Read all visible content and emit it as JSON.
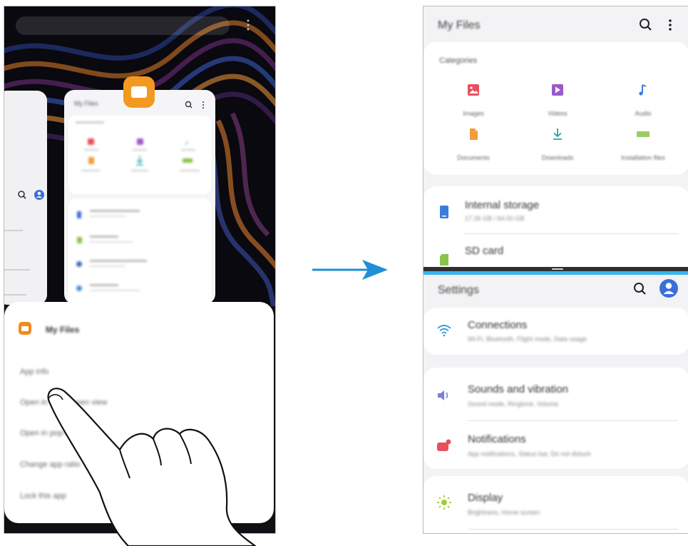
{
  "left_phone": {
    "thumbnail_title": "My Files",
    "sheet": {
      "title": "My Files",
      "menu_items": [
        "App info",
        "Open in split screen view",
        "Open in pop-up view",
        "Change app ratio",
        "Lock this app"
      ]
    }
  },
  "my_files": {
    "title": "My Files",
    "categories_header": "Categories",
    "categories": [
      {
        "label": "Images",
        "icon": "image-icon",
        "color": "#e8505b"
      },
      {
        "label": "Videos",
        "icon": "video-icon",
        "color": "#9b59c9"
      },
      {
        "label": "Audio",
        "icon": "music-icon",
        "color": "#3b7ddd"
      },
      {
        "label": "Documents",
        "icon": "document-icon",
        "color": "#f39c3a"
      },
      {
        "label": "Downloads",
        "icon": "download-icon",
        "color": "#22a7a0"
      },
      {
        "label": "Installation files",
        "icon": "apk-icon",
        "color": "#8bc34a"
      }
    ],
    "storage": [
      {
        "title": "Internal storage",
        "sub": "17.26 GB / 64.00 GB",
        "icon": "phone-storage-icon"
      },
      {
        "title": "SD card",
        "sub": "",
        "icon": "sd-card-icon"
      }
    ]
  },
  "settings": {
    "title": "Settings",
    "items": [
      {
        "title": "Connections",
        "sub": "Wi-Fi, Bluetooth, Flight mode, Data usage",
        "icon": "wifi-icon"
      },
      {
        "title": "Sounds and vibration",
        "sub": "Sound mode, Ringtone, Volume",
        "icon": "volume-icon"
      },
      {
        "title": "Notifications",
        "sub": "App notifications, Status bar, Do not disturb",
        "icon": "notification-icon"
      },
      {
        "title": "Display",
        "sub": "Brightness, Home screen",
        "icon": "brightness-icon"
      }
    ]
  },
  "colors": {
    "accent_blue": "#36b6f0",
    "arrow_blue": "#1f8fd6",
    "orange": "#f29a1f"
  }
}
